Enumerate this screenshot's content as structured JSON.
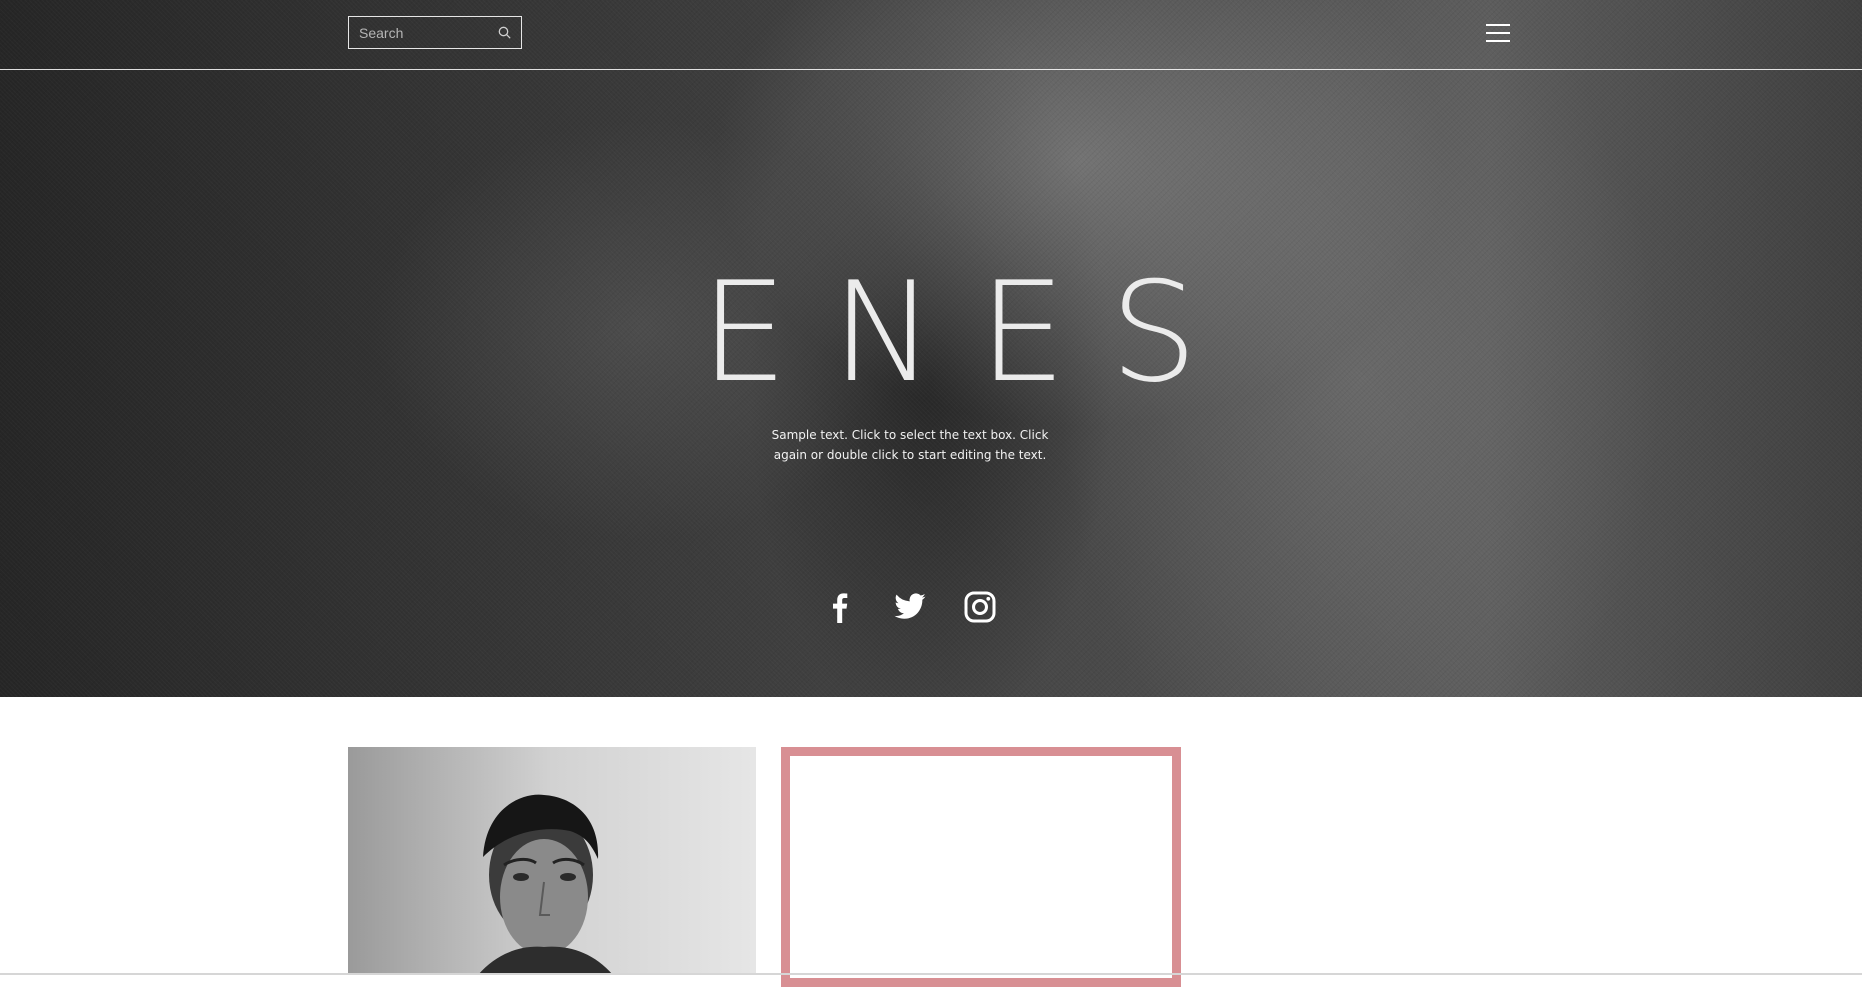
{
  "header": {
    "search": {
      "placeholder": "Search",
      "icon": "search-icon"
    },
    "menu": {
      "icon": "hamburger-menu-icon"
    }
  },
  "hero": {
    "title": "ENES",
    "text": "Sample text. Click to select the text box. Click again or double click to start editing the text."
  },
  "social": [
    {
      "name": "facebook",
      "icon": "facebook-icon"
    },
    {
      "name": "twitter",
      "icon": "twitter-icon"
    },
    {
      "name": "instagram",
      "icon": "instagram-icon"
    }
  ],
  "colors": {
    "accent_border": "#d88f93",
    "hero_text": "#ebebeb",
    "background": "#ffffff"
  }
}
